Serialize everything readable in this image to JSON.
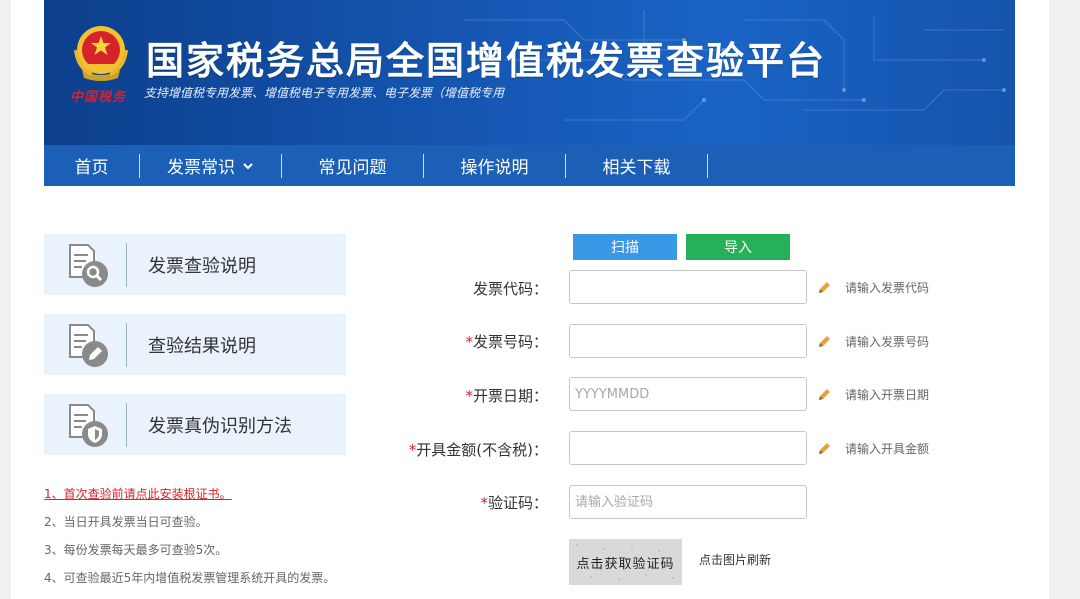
{
  "header": {
    "title": "国家税务总局全国增值税发票查验平台",
    "subtitle": "支持增值税专用发票、增值税电子专用发票、电子发票（增值税专用",
    "logo_text": "中国税务"
  },
  "nav": {
    "items": [
      {
        "label": "首页"
      },
      {
        "label": "发票常识",
        "has_dropdown": true
      },
      {
        "label": "常见问题"
      },
      {
        "label": "操作说明"
      },
      {
        "label": "相关下载"
      }
    ]
  },
  "sidebar": {
    "cards": [
      {
        "label": "发票查验说明",
        "icon": "document-search-icon"
      },
      {
        "label": "查验结果说明",
        "icon": "document-edit-icon"
      },
      {
        "label": "发票真伪识别方法",
        "icon": "document-shield-icon"
      }
    ],
    "notes": [
      "1、首次查验前请点此安装根证书。",
      "2、当日开具发票当日可查验。",
      "3、每份发票每天最多可查验5次。",
      "4、可查验最近5年内增值税发票管理系统开具的发票。"
    ]
  },
  "form": {
    "scan_label": "扫描",
    "import_label": "导入",
    "fields": [
      {
        "required": "",
        "label": "发票代码：",
        "value": "",
        "placeholder": "",
        "hint": "请输入发票代码"
      },
      {
        "required": "*",
        "label": "发票号码：",
        "value": "",
        "placeholder": "",
        "hint": "请输入发票号码"
      },
      {
        "required": "*",
        "label": "开票日期：",
        "value": "",
        "placeholder": "YYYYMMDD",
        "hint": "请输入开票日期"
      },
      {
        "required": "*",
        "label": "开具金额(不含税)：",
        "value": "",
        "placeholder": "",
        "hint": "请输入开具金额"
      }
    ],
    "captcha": {
      "required": "*",
      "label": "验证码：",
      "placeholder": "请输入验证码",
      "image_text": "点击获取验证码",
      "refresh_label": "点击图片刷新"
    }
  },
  "colors": {
    "header_blue": "#1657b3",
    "nav_blue": "#1b5fb6",
    "card_bg": "#eaf3fb",
    "scan_button": "#3a98e6",
    "import_button": "#27b05a",
    "required_red": "#d6222a",
    "pencil_orange": "#e8a23a"
  }
}
